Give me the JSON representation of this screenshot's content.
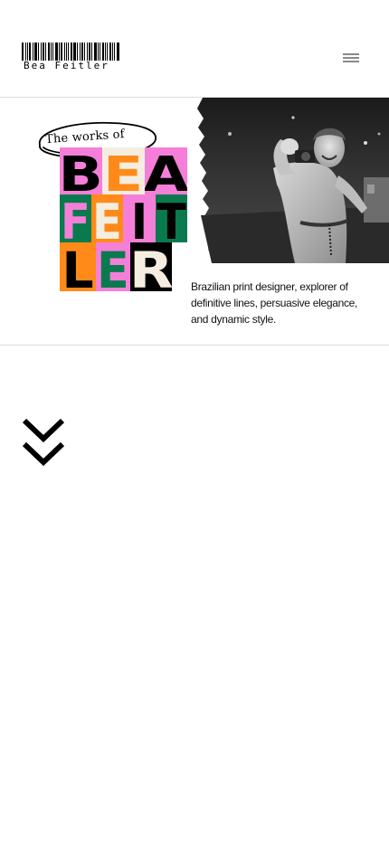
{
  "header": {
    "logo_text": "Bea Feitler",
    "menu_icon": "hamburger-icon"
  },
  "hero": {
    "oval_text": "The works of",
    "grid": [
      {
        "letter": "B",
        "bg": "#f57fd8",
        "fg": "#000000"
      },
      {
        "letter": "E",
        "bg": "#f5ede0",
        "fg": "#ff8a1a"
      },
      {
        "letter": "A",
        "bg": "#f57fd8",
        "fg": "#000000"
      },
      {
        "letter": "F",
        "bg": "#0a7a4e",
        "fg": "#f57fd8"
      },
      {
        "letter": "E",
        "bg": "#ff8a1a",
        "fg": "#f5ede0"
      },
      {
        "letter": "I",
        "bg": "#f57fd8",
        "fg": "#000000"
      },
      {
        "letter": "T",
        "bg": "#0a7a4e",
        "fg": "#000000"
      },
      {
        "letter": "L",
        "bg": "#ff8a1a",
        "fg": "#000000"
      },
      {
        "letter": "E",
        "bg": "#f57fd8",
        "fg": "#0a7a4e"
      },
      {
        "letter": "R",
        "bg": "#000000",
        "fg": "#f5ede0"
      }
    ],
    "photo_alt": "black-and-white-portrait",
    "description": "Brazilian print designer, explorer of definitive lines, persuasive elegance, and dynamic style.",
    "scroll_icon": "double-chevron-down-icon"
  },
  "colors": {
    "pink": "#f57fd8",
    "green": "#0a7a4e",
    "orange": "#ff8a1a",
    "cream": "#f5ede0",
    "divider": "#dcdcdc"
  }
}
